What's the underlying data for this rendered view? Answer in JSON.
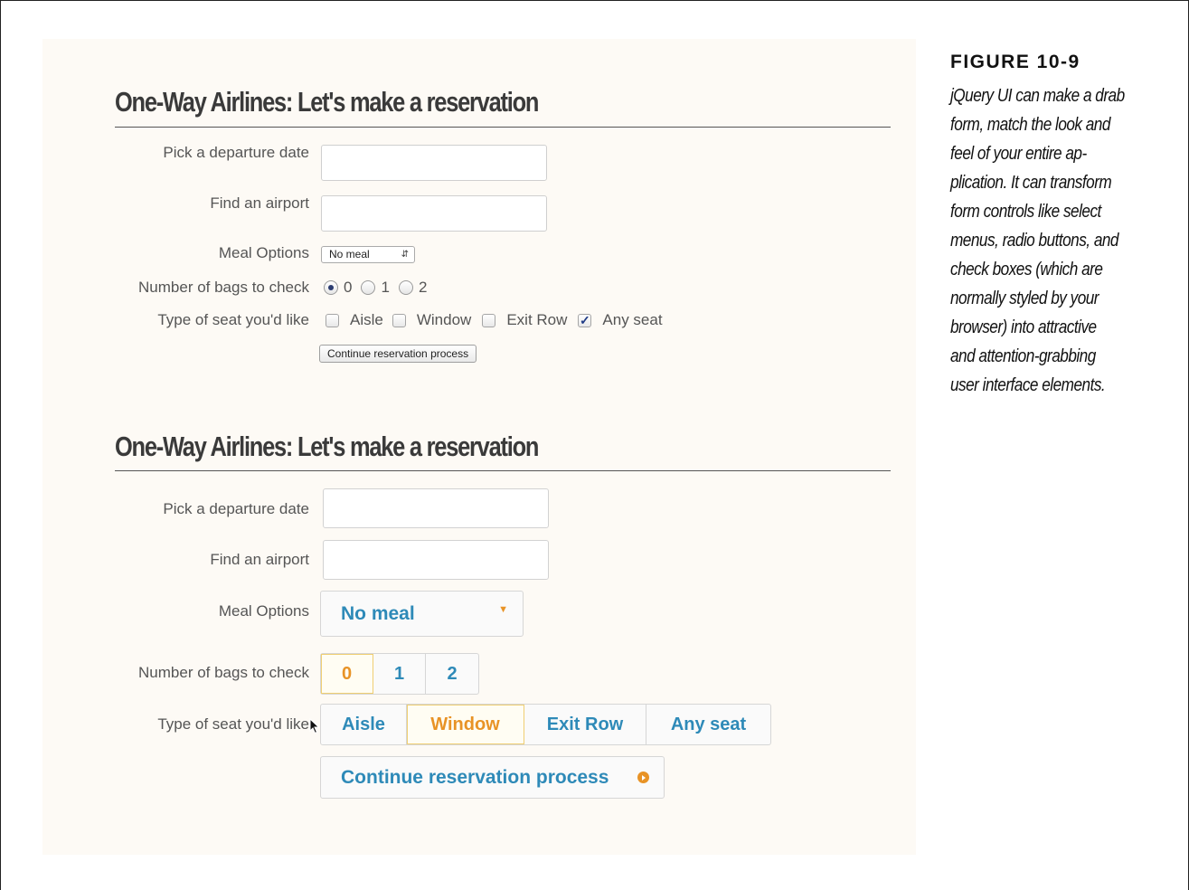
{
  "figure": {
    "label": "FIGURE 10-9",
    "caption_lines": [
      "jQuery UI can make a drab",
      "form, match the look and",
      "feel of your entire ap-",
      "plication. It can transform",
      "form controls like select",
      "menus, radio buttons, and",
      "check boxes (which are",
      "normally styled by your",
      "browser) into attractive",
      "and attention-grabbing",
      "user interface elements."
    ]
  },
  "form_plain": {
    "heading": "One-Way Airlines: Let's make a reservation",
    "date_label": "Pick a departure date",
    "date_value": "",
    "airport_label": "Find an airport",
    "airport_value": "",
    "meal_label": "Meal Options",
    "meal_selected": "No meal",
    "bags_label": "Number of bags to check",
    "bags_options": [
      "0",
      "1",
      "2"
    ],
    "bags_selected": "0",
    "seat_label": "Type of seat you'd like",
    "seat_options": [
      "Aisle",
      "Window",
      "Exit Row",
      "Any seat"
    ],
    "seat_checked": "Any seat",
    "submit_label": "Continue reservation process"
  },
  "form_styled": {
    "heading": "One-Way Airlines: Let's make a reservation",
    "date_label": "Pick a departure date",
    "date_value": "",
    "airport_label": "Find an airport",
    "airport_value": "",
    "meal_label": "Meal Options",
    "meal_selected": "No meal",
    "bags_label": "Number of bags to check",
    "bags_options": [
      "0",
      "1",
      "2"
    ],
    "bags_selected": "0",
    "seat_label": "Type of seat you'd like",
    "seat_options": [
      "Aisle",
      "Window",
      "Exit Row",
      "Any seat"
    ],
    "seat_highlighted": "Window",
    "submit_label": "Continue reservation process"
  },
  "colors": {
    "accent_blue": "#2e8ab8",
    "accent_orange": "#e89326",
    "panel_background": "#fdfaf5"
  }
}
